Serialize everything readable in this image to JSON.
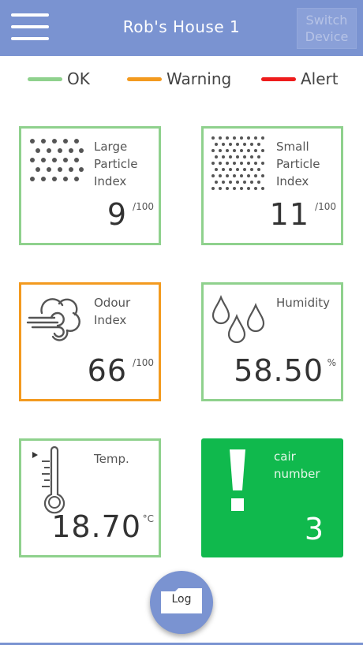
{
  "header": {
    "title": "Rob's House 1",
    "switch_label_line1": "Switch",
    "switch_label_line2": "Device",
    "menu_icon": "hamburger-menu-icon"
  },
  "legend": [
    {
      "label": "OK",
      "color": "#8fd18d"
    },
    {
      "label": "Warning",
      "color": "#f39a1f"
    },
    {
      "label": "Alert",
      "color": "#ee1c1c"
    }
  ],
  "cards": {
    "large_particle": {
      "label_lines": [
        "Large",
        "Particle",
        "Index"
      ],
      "value": "9",
      "unit": "/100",
      "status": "ok",
      "icon": "large-particles-icon"
    },
    "small_particle": {
      "label_lines": [
        "Small",
        "Particle",
        "Index"
      ],
      "value": "11",
      "unit": "/100",
      "status": "ok",
      "icon": "small-particles-icon"
    },
    "odour": {
      "label_lines": [
        "Odour",
        "Index"
      ],
      "value": "66",
      "unit": "/100",
      "status": "warning",
      "icon": "wind-cloud-icon"
    },
    "humidity": {
      "label_lines": [
        "Humidity"
      ],
      "value": "58.50",
      "unit": "%",
      "status": "ok",
      "icon": "water-drops-icon"
    },
    "temp": {
      "label_lines": [
        "Temp."
      ],
      "value": "18.70",
      "unit": "°C",
      "status": "ok",
      "icon": "thermometer-icon"
    },
    "cair": {
      "label_lines": [
        "cair",
        "number"
      ],
      "value": "3",
      "status": "ok-filled",
      "icon": "exclamation-icon"
    }
  },
  "colors": {
    "accent": "#7a93d1",
    "ok": "#8fd18d",
    "warning": "#f39a1f",
    "alert": "#ee1c1c",
    "cair_bg": "#10b94d"
  },
  "log_button": {
    "label": "Log",
    "icon": "folder-icon"
  }
}
